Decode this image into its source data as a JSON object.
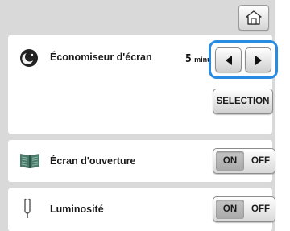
{
  "header": {
    "home_icon": "home-icon"
  },
  "screensaver": {
    "label": "Économiseur d'écran",
    "icon": "moon-icon",
    "value_digit": "5",
    "value_unit": "minutes",
    "prev_icon": "left-arrow-icon",
    "next_icon": "right-arrow-icon",
    "selection_label": "SELECTION",
    "highlight_color": "#2a8ce0"
  },
  "opening_screen": {
    "label": "Écran d'ouverture",
    "icon": "book-icon",
    "on_label": "ON",
    "off_label": "OFF",
    "state": "ON"
  },
  "brightness": {
    "label": "Luminosité",
    "icon": "bulb-icon",
    "on_label": "ON",
    "off_label": "OFF",
    "state": "ON"
  }
}
